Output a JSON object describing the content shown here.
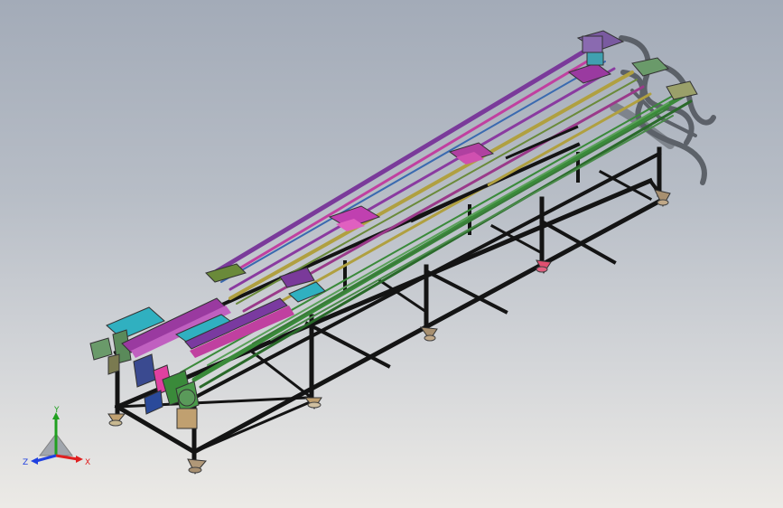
{
  "viewport": {
    "scene": "conveyor-assembly-3d-model"
  },
  "triad": {
    "x_label": "X",
    "y_label": "Y",
    "z_label": "Z",
    "x_color": "#e02020",
    "y_color": "#20a020",
    "z_color": "#2040e0"
  },
  "colors": {
    "frame": "#151515",
    "rail_green": "#3a8a3a",
    "rail_purple": "#7a3a9a",
    "rail_magenta": "#c040a0",
    "rail_yellow": "#b0a040",
    "cyan_parts": "#30b0c0",
    "shadow": "#555a60"
  }
}
